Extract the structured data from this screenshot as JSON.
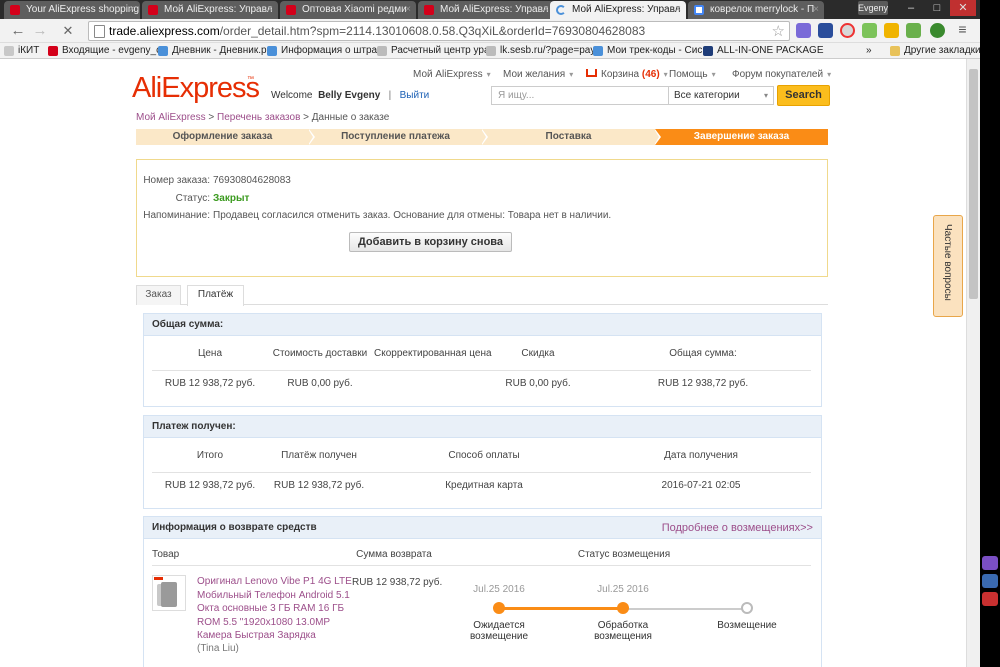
{
  "browser": {
    "tabs": [
      {
        "title": "Your AliExpress shopping",
        "favicon": "mail-icon"
      },
      {
        "title": "Мой AliExpress: Управл",
        "favicon": "mail-icon"
      },
      {
        "title": "Оптовая Xiaomi редми",
        "favicon": "mail-icon"
      },
      {
        "title": "Мой AliExpress: Управл",
        "favicon": "mail-icon"
      },
      {
        "title": "Мой AliExpress: Управл",
        "favicon": "loading-icon",
        "active": true
      },
      {
        "title": "коврелок merrylock - П",
        "favicon": "google-icon"
      }
    ],
    "close_glyph": "×",
    "user_badge": "Evgeny",
    "window_buttons": {
      "minimize": "–",
      "maximize": "□",
      "close": "✕"
    },
    "nav": {
      "back": "←",
      "forward": "→",
      "stop": "✕"
    },
    "url_host": "trade.aliexpress.com",
    "url_path": "/order_detail.htm?spm=2114.13010608.0.58.Q3qXiL&orderId=76930804628083",
    "star_glyph": "☆",
    "bookmarks": [
      {
        "label": "iКИТ",
        "color": "#d4001a"
      },
      {
        "label": "Входящие - evgeny_c",
        "color": "#d4001a"
      },
      {
        "label": "Дневник - Дневник.р",
        "color": "#4a90d9"
      },
      {
        "label": "Информация о штра",
        "color": "#4a90d9"
      },
      {
        "label": "Расчетный центр ура",
        "color": "#888888"
      },
      {
        "label": "lk.sesb.ru/?page=pay",
        "color": "#888888"
      },
      {
        "label": "Мои трек-коды - Сис",
        "color": "#4a90d9"
      },
      {
        "label": "ALL-IN-ONE PACKAGE",
        "color": "#1e3c78"
      }
    ],
    "bookmarks_more": "»",
    "other_bookmarks": "Другие закладки"
  },
  "header": {
    "logo": "AliExpress",
    "logo_tm": "™",
    "my_aliexpress": "Мой AliExpress",
    "wishlist": "Мои желания",
    "cart_label": "Корзина",
    "cart_count": "(46)",
    "help": "Помощь",
    "forum": "Форум покупателей",
    "caret": "▾",
    "welcome": "Welcome",
    "username": "Belly Evgeny",
    "separator": "|",
    "logout": "Выйти",
    "search_placeholder": "Я ищу...",
    "category": "Все категории",
    "search_button": "Search"
  },
  "breadcrumb": {
    "items": [
      "Мой AliExpress",
      "Перечень заказов",
      "Данные о заказе"
    ],
    "separator": " > "
  },
  "steps": [
    "Оформление заказа",
    "Поступление платежа",
    "Поставка",
    "Завершение заказа"
  ],
  "order": {
    "number_label": "Номер заказа:",
    "number": "76930804628083",
    "status_label": "Статус:",
    "status": "Закрыт",
    "reminder_label": "Напоминание:",
    "reminder": "Продавец согласился отменить заказ. Основание для отмены: Товара нет в наличии.",
    "add_to_cart": "Добавить в корзину снова"
  },
  "subtabs": [
    "Заказ",
    "Платёж"
  ],
  "total": {
    "title": "Общая сумма:",
    "headers": [
      "Цена",
      "Стоимость доставки",
      "Скорректированная цена",
      "Скидка",
      "Общая сумма:"
    ],
    "values": [
      "RUB 12 938,72 руб.",
      "RUB 0,00 руб.",
      "",
      "RUB 0,00 руб.",
      "RUB 12 938,72 руб."
    ]
  },
  "payment": {
    "title": "Платеж получен:",
    "headers": [
      "Итого",
      "Платёж получен",
      "Способ оплаты",
      "Дата получения"
    ],
    "values": [
      "RUB 12 938,72 руб.",
      "RUB 12 938,72 руб.",
      "Кредитная карта",
      "2016-07-21 02:05"
    ]
  },
  "refund": {
    "title": "Информация о возврате средств",
    "more_link": "Подробнее о возмещениях>>",
    "headers": [
      "Товар",
      "Сумма возврата",
      "Статус возмещения"
    ],
    "product_title": "Оригинал Lenovo Vibe P1 4G LTE Мобильный Телефон Android 5.1 Окта основные 3 ГБ RAM 16 ГБ ROM 5.5 \"1920x1080 13.0MP Камера Быстрая Зарядка",
    "seller": "(Tina Liu)",
    "amount": "RUB 12 938,72 руб.",
    "timeline": [
      {
        "date": "Jul.25 2016",
        "label": "Ожидается возмещение",
        "done": true
      },
      {
        "date": "Jul.25 2016",
        "label": "Обработка возмещения",
        "done": true
      },
      {
        "date": "",
        "label": "Возмещение",
        "done": false
      }
    ]
  },
  "faq": {
    "label": "Частые вопросы",
    "badge": "?"
  },
  "colors": {
    "accent": "#e62e04",
    "step_active": "#fa8c16",
    "status_ok": "#3a9a1e",
    "link": "#9c4e8a",
    "search_button": "#fbbd1d"
  }
}
